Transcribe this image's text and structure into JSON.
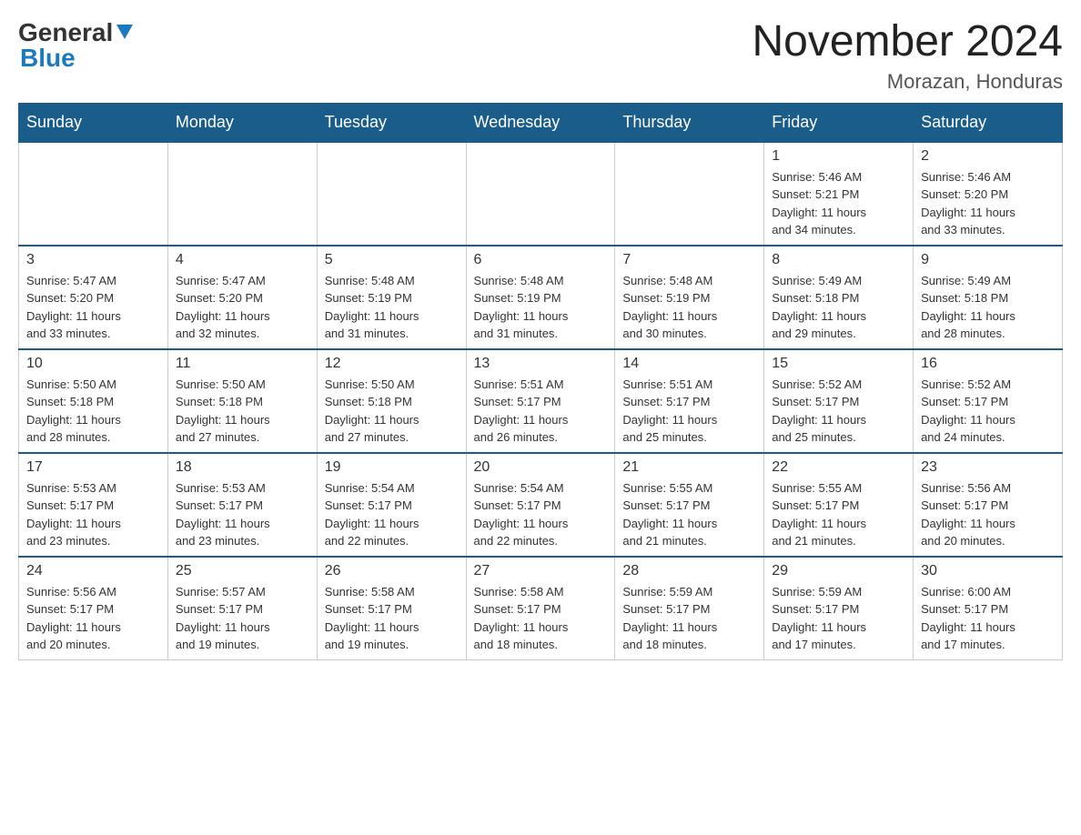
{
  "logo": {
    "general": "General",
    "blue": "Blue"
  },
  "title": "November 2024",
  "subtitle": "Morazan, Honduras",
  "days_of_week": [
    "Sunday",
    "Monday",
    "Tuesday",
    "Wednesday",
    "Thursday",
    "Friday",
    "Saturday"
  ],
  "weeks": [
    [
      {
        "day": "",
        "info": ""
      },
      {
        "day": "",
        "info": ""
      },
      {
        "day": "",
        "info": ""
      },
      {
        "day": "",
        "info": ""
      },
      {
        "day": "",
        "info": ""
      },
      {
        "day": "1",
        "info": "Sunrise: 5:46 AM\nSunset: 5:21 PM\nDaylight: 11 hours\nand 34 minutes."
      },
      {
        "day": "2",
        "info": "Sunrise: 5:46 AM\nSunset: 5:20 PM\nDaylight: 11 hours\nand 33 minutes."
      }
    ],
    [
      {
        "day": "3",
        "info": "Sunrise: 5:47 AM\nSunset: 5:20 PM\nDaylight: 11 hours\nand 33 minutes."
      },
      {
        "day": "4",
        "info": "Sunrise: 5:47 AM\nSunset: 5:20 PM\nDaylight: 11 hours\nand 32 minutes."
      },
      {
        "day": "5",
        "info": "Sunrise: 5:48 AM\nSunset: 5:19 PM\nDaylight: 11 hours\nand 31 minutes."
      },
      {
        "day": "6",
        "info": "Sunrise: 5:48 AM\nSunset: 5:19 PM\nDaylight: 11 hours\nand 31 minutes."
      },
      {
        "day": "7",
        "info": "Sunrise: 5:48 AM\nSunset: 5:19 PM\nDaylight: 11 hours\nand 30 minutes."
      },
      {
        "day": "8",
        "info": "Sunrise: 5:49 AM\nSunset: 5:18 PM\nDaylight: 11 hours\nand 29 minutes."
      },
      {
        "day": "9",
        "info": "Sunrise: 5:49 AM\nSunset: 5:18 PM\nDaylight: 11 hours\nand 28 minutes."
      }
    ],
    [
      {
        "day": "10",
        "info": "Sunrise: 5:50 AM\nSunset: 5:18 PM\nDaylight: 11 hours\nand 28 minutes."
      },
      {
        "day": "11",
        "info": "Sunrise: 5:50 AM\nSunset: 5:18 PM\nDaylight: 11 hours\nand 27 minutes."
      },
      {
        "day": "12",
        "info": "Sunrise: 5:50 AM\nSunset: 5:18 PM\nDaylight: 11 hours\nand 27 minutes."
      },
      {
        "day": "13",
        "info": "Sunrise: 5:51 AM\nSunset: 5:17 PM\nDaylight: 11 hours\nand 26 minutes."
      },
      {
        "day": "14",
        "info": "Sunrise: 5:51 AM\nSunset: 5:17 PM\nDaylight: 11 hours\nand 25 minutes."
      },
      {
        "day": "15",
        "info": "Sunrise: 5:52 AM\nSunset: 5:17 PM\nDaylight: 11 hours\nand 25 minutes."
      },
      {
        "day": "16",
        "info": "Sunrise: 5:52 AM\nSunset: 5:17 PM\nDaylight: 11 hours\nand 24 minutes."
      }
    ],
    [
      {
        "day": "17",
        "info": "Sunrise: 5:53 AM\nSunset: 5:17 PM\nDaylight: 11 hours\nand 23 minutes."
      },
      {
        "day": "18",
        "info": "Sunrise: 5:53 AM\nSunset: 5:17 PM\nDaylight: 11 hours\nand 23 minutes."
      },
      {
        "day": "19",
        "info": "Sunrise: 5:54 AM\nSunset: 5:17 PM\nDaylight: 11 hours\nand 22 minutes."
      },
      {
        "day": "20",
        "info": "Sunrise: 5:54 AM\nSunset: 5:17 PM\nDaylight: 11 hours\nand 22 minutes."
      },
      {
        "day": "21",
        "info": "Sunrise: 5:55 AM\nSunset: 5:17 PM\nDaylight: 11 hours\nand 21 minutes."
      },
      {
        "day": "22",
        "info": "Sunrise: 5:55 AM\nSunset: 5:17 PM\nDaylight: 11 hours\nand 21 minutes."
      },
      {
        "day": "23",
        "info": "Sunrise: 5:56 AM\nSunset: 5:17 PM\nDaylight: 11 hours\nand 20 minutes."
      }
    ],
    [
      {
        "day": "24",
        "info": "Sunrise: 5:56 AM\nSunset: 5:17 PM\nDaylight: 11 hours\nand 20 minutes."
      },
      {
        "day": "25",
        "info": "Sunrise: 5:57 AM\nSunset: 5:17 PM\nDaylight: 11 hours\nand 19 minutes."
      },
      {
        "day": "26",
        "info": "Sunrise: 5:58 AM\nSunset: 5:17 PM\nDaylight: 11 hours\nand 19 minutes."
      },
      {
        "day": "27",
        "info": "Sunrise: 5:58 AM\nSunset: 5:17 PM\nDaylight: 11 hours\nand 18 minutes."
      },
      {
        "day": "28",
        "info": "Sunrise: 5:59 AM\nSunset: 5:17 PM\nDaylight: 11 hours\nand 18 minutes."
      },
      {
        "day": "29",
        "info": "Sunrise: 5:59 AM\nSunset: 5:17 PM\nDaylight: 11 hours\nand 17 minutes."
      },
      {
        "day": "30",
        "info": "Sunrise: 6:00 AM\nSunset: 5:17 PM\nDaylight: 11 hours\nand 17 minutes."
      }
    ]
  ]
}
